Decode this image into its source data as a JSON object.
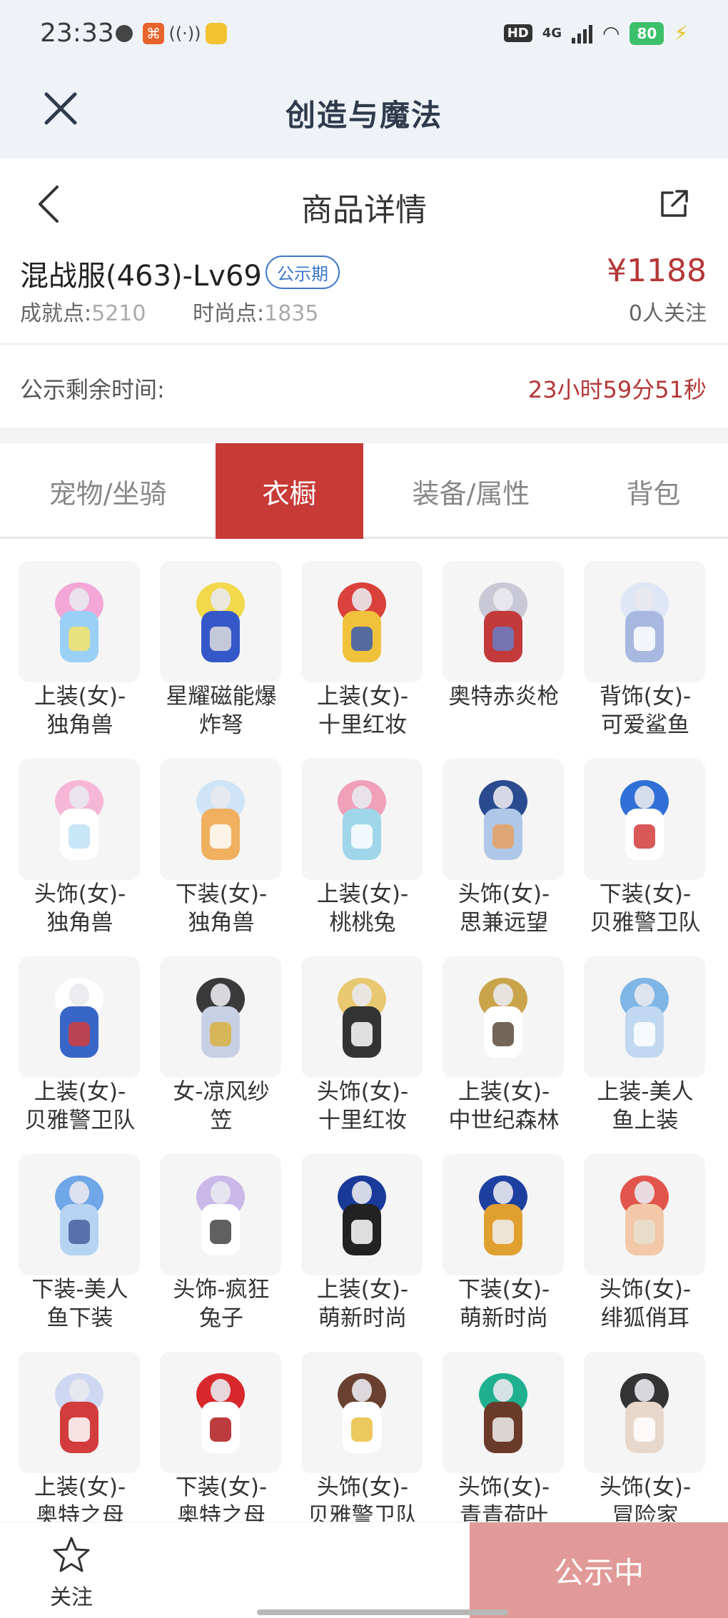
{
  "status_bar": {
    "time": "23:33",
    "network": "4G",
    "battery": "80"
  },
  "app": {
    "title": "创造与魔法"
  },
  "nav": {
    "title": "商品详情"
  },
  "product": {
    "name": "混战服(463)-Lv69",
    "badge": "公示期",
    "price": "¥1188",
    "achievement_label": "成就点:",
    "achievement_value": "5210",
    "fashion_label": "时尚点:",
    "fashion_value": "1835",
    "followers": "0人关注"
  },
  "countdown": {
    "label": "公示剩余时间:",
    "value": "23小时59分51秒"
  },
  "tabs": [
    {
      "label": "宠物/坐骑"
    },
    {
      "label": "衣橱",
      "active": true
    },
    {
      "label": "装备/属性"
    },
    {
      "label": "背包"
    }
  ],
  "items": [
    {
      "line1": "上装(女)-",
      "line2": "独角兽",
      "icon": "wings-outfit-icon"
    },
    {
      "line1": "星耀磁能爆",
      "line2": "炸弩",
      "icon": "crossbow-icon"
    },
    {
      "line1": "上装(女)-",
      "line2": "十里红妆",
      "icon": "red-robe-icon"
    },
    {
      "line1": "奥特赤炎枪",
      "line2": "",
      "icon": "spear-icon"
    },
    {
      "line1": "背饰(女)-",
      "line2": "可爱鲨鱼",
      "icon": "shark-backpack-icon"
    },
    {
      "line1": "头饰(女)-",
      "line2": "独角兽",
      "icon": "unicorn-hood-icon"
    },
    {
      "line1": "下装(女)-",
      "line2": "独角兽",
      "icon": "boots-icon"
    },
    {
      "line1": "上装(女)-",
      "line2": "桃桃兔",
      "icon": "pink-dress-icon"
    },
    {
      "line1": "头饰(女)-",
      "line2": "思兼远望",
      "icon": "space-helmet-icon"
    },
    {
      "line1": "下装(女)-",
      "line2": "贝雅警卫队",
      "icon": "leggings-icon"
    },
    {
      "line1": "上装(女)-",
      "line2": "贝雅警卫队",
      "icon": "jacket-icon"
    },
    {
      "line1": "女-凉风纱",
      "line2": "笠",
      "icon": "veil-hat-icon"
    },
    {
      "line1": "头饰(女)-",
      "line2": "十里红妆",
      "icon": "crown-head-icon"
    },
    {
      "line1": "上装(女)-",
      "line2": "中世纪森林",
      "icon": "medieval-outfit-icon"
    },
    {
      "line1": "上装-美人",
      "line2": "鱼上装",
      "icon": "mermaid-top-icon"
    },
    {
      "line1": "下装-美人",
      "line2": "鱼下装",
      "icon": "mermaid-tail-icon"
    },
    {
      "line1": "头饰-疯狂",
      "line2": "兔子",
      "icon": "bunny-hood-icon"
    },
    {
      "line1": "上装(女)-",
      "line2": "萌新时尚",
      "icon": "blue-corset-icon"
    },
    {
      "line1": "下装(女)-",
      "line2": "萌新时尚",
      "icon": "blue-skirt-icon"
    },
    {
      "line1": "头饰(女)-",
      "line2": "绯狐俏耳",
      "icon": "fox-ears-head-icon"
    },
    {
      "line1": "上装(女)-",
      "line2": "奥特之母",
      "icon": "ultra-suit-icon"
    },
    {
      "line1": "下装(女)-",
      "line2": "奥特之母",
      "icon": "red-boots-icon"
    },
    {
      "line1": "头饰(女)-",
      "line2": "贝雅警卫队",
      "icon": "headphones-head-icon"
    },
    {
      "line1": "头饰(女)-",
      "line2": "青青荷叶",
      "icon": "lotus-leaf-hat-icon"
    },
    {
      "line1": "头饰(女)-",
      "line2": "冒险家",
      "icon": "short-hair-head-icon"
    }
  ],
  "bottom": {
    "follow_label": "关注",
    "status_label": "公示中"
  },
  "colors": {
    "accent": "#c73a36",
    "price": "#b53737",
    "badge": "#3e78c9",
    "status_button": "#e19a98"
  }
}
